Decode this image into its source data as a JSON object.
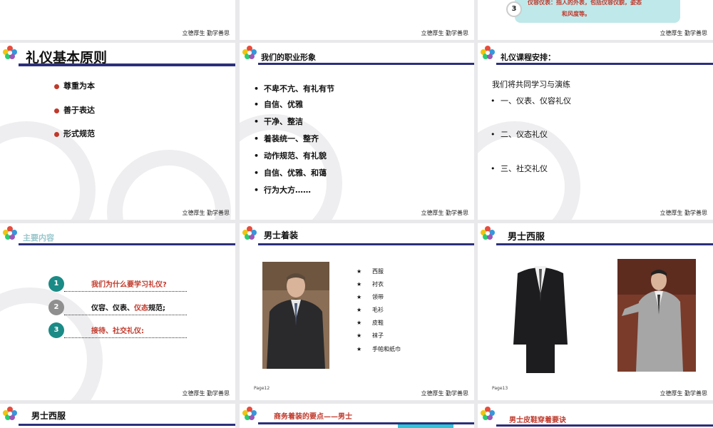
{
  "signature": "立德厚生 勤学善思",
  "top_row": {
    "c_badge": "3",
    "c_text_line1": "仪容仪表：指人的外表，包括仪容仪貌，姿态",
    "c_text_line2": "和风度等。"
  },
  "slide_principles": {
    "title": "礼仪基本原则",
    "items": [
      "尊重为本",
      "善于表达",
      "形式规范"
    ]
  },
  "slide_image": {
    "title": "我们的职业形象",
    "items": [
      "不卑不亢、有礼有节",
      "自信、优雅",
      "干净、整洁",
      "着装统一、整齐",
      "动作规范、有礼貌",
      "自信、优雅、和蔼",
      "行为大方……"
    ]
  },
  "slide_course": {
    "title": "礼仪课程安排：",
    "intro": "我们将共同学习与演练",
    "items": [
      "一、仪表、仪容礼仪",
      "二、仪态礼仪",
      "三、社交礼仪"
    ]
  },
  "slide_contents": {
    "title": "主要内容",
    "items": [
      {
        "num": "1",
        "text": "我们为什么要学习礼仪?"
      },
      {
        "num": "2",
        "text_pre": "仪容、仪表、",
        "text_hl": "仪态",
        "text_post": "规范;"
      },
      {
        "num": "3",
        "text": "接待、社交礼仪:"
      }
    ]
  },
  "slide_men_dress": {
    "title": "男士着装",
    "items": [
      "西服",
      "衬衣",
      "领带",
      "毛衫",
      "皮鞋",
      "袜子",
      "手帕和纸巾"
    ],
    "page": "Page12"
  },
  "slide_men_suit": {
    "title": "男士西服",
    "page": "Page13"
  },
  "bottom_row": {
    "a_title": "男士西服",
    "b_title": "商务着装的要点——男士",
    "c_title": "男士皮鞋穿着要诀"
  },
  "colors": {
    "bar": "#2b2f7a",
    "red": "#c0392b",
    "teal": "#1a8b86",
    "gray": "#8f8f8f"
  }
}
